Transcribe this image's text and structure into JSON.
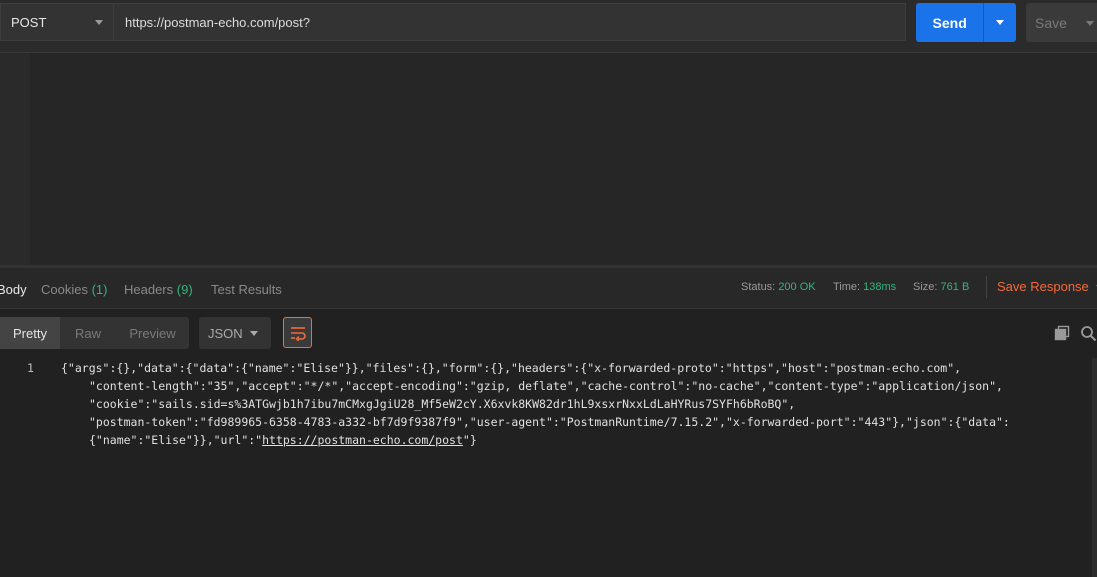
{
  "request": {
    "method": "POST",
    "url": "https://postman-echo.com/post?",
    "send_label": "Send",
    "save_label": "Save"
  },
  "response": {
    "tabs": [
      {
        "label": "Body",
        "count": ""
      },
      {
        "label": "Cookies",
        "count": "(1)"
      },
      {
        "label": "Headers",
        "count": "(9)"
      },
      {
        "label": "Test Results",
        "count": ""
      }
    ],
    "status_label": "Status:",
    "status_value": "200 OK",
    "time_label": "Time:",
    "time_value": "138ms",
    "size_label": "Size:",
    "size_value": "761 B",
    "save_response_label": "Save Response",
    "view_modes": [
      "Pretty",
      "Raw",
      "Preview"
    ],
    "format": "JSON",
    "line_number": "1",
    "body_lines": [
      "{\"args\":{},\"data\":{\"data\":{\"name\":\"Elise\"}},\"files\":{},\"form\":{},\"headers\":{\"x-forwarded-proto\":\"https\",\"host\":\"postman-echo.com\",",
      "\"content-length\":\"35\",\"accept\":\"*/*\",\"accept-encoding\":\"gzip, deflate\",\"cache-control\":\"no-cache\",\"content-type\":\"application/json\",",
      "\"cookie\":\"sails.sid=s%3ATGwjb1h7ibu7mCMxgJgiU28_Mf5eW2cY.X6xvk8KW82dr1hL9xsxrNxxLdLaHYRus7SYFh6bRoBQ\",",
      "\"postman-token\":\"fd989965-6358-4783-a332-bf7d9f9387f9\",\"user-agent\":\"PostmanRuntime/7.15.2\",\"x-forwarded-port\":\"443\"},\"json\":{\"data\":",
      "{\"name\":\"Elise\"}},\"url\":\""
    ],
    "body_url": "https://postman-echo.com/post",
    "body_end": "\"}"
  },
  "colors": {
    "accent_blue": "#1a73e8",
    "accent_orange": "#f26b3a",
    "status_green": "#36b37e"
  },
  "icons": {
    "copy": "copy-icon",
    "search": "search-icon",
    "wrap": "wrap-lines-icon"
  }
}
